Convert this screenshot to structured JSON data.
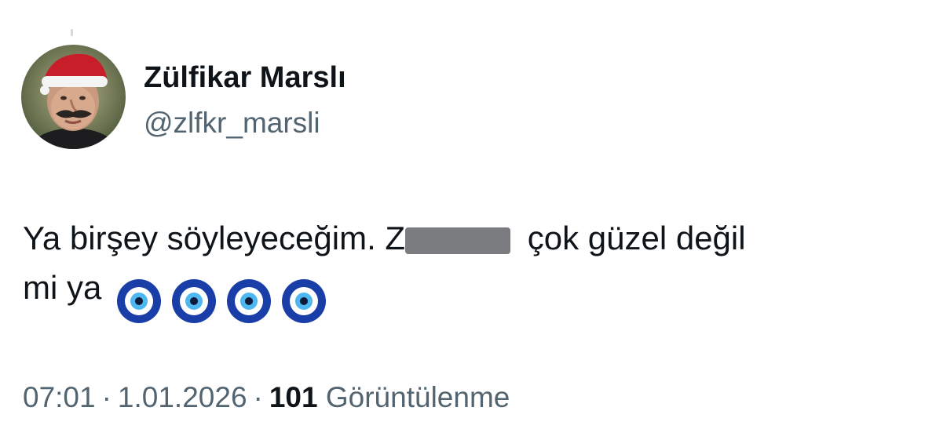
{
  "author": {
    "display_name": "Zülfikar Marslı",
    "handle": "@zlfkr_marsli"
  },
  "tweet": {
    "text_part1": "Ya birşey söyleyeceğim. Z",
    "text_part2": " çok güzel değil",
    "text_part3": "mi ya",
    "emoji_icons": [
      "nazar-icon",
      "nazar-icon",
      "nazar-icon",
      "nazar-icon"
    ]
  },
  "meta": {
    "time": "07:01",
    "date": "1.01.2026",
    "separator": "·",
    "views_count": "101",
    "views_label": "Görüntülenme"
  },
  "colors": {
    "text": "#0f1419",
    "secondary": "#536471",
    "nazar_blue": "#1a3ea8"
  }
}
